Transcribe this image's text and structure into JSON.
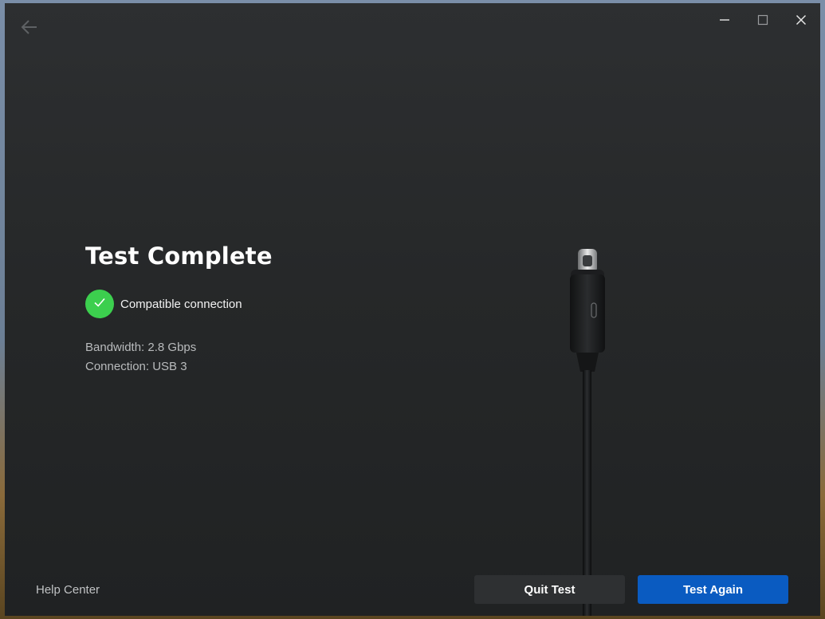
{
  "titlebar": {
    "back_icon": "arrow-left-icon",
    "controls": [
      "minimize-icon",
      "maximize-icon",
      "close-icon"
    ]
  },
  "main": {
    "title": "Test Complete",
    "status": {
      "icon": "check-icon",
      "text": "Compatible connection",
      "color": "#3ccf4e"
    },
    "bandwidth": "Bandwidth: 2.8 Gbps",
    "connection": "Connection: USB 3"
  },
  "footer": {
    "help_label": "Help Center",
    "quit_label": "Quit Test",
    "again_label": "Test Again",
    "accent_color": "#0a5bc1"
  }
}
